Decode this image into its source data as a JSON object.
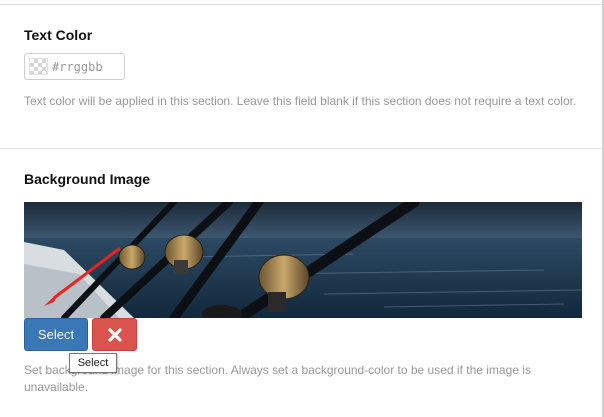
{
  "text_color": {
    "label": "Text Color",
    "input_placeholder": "#rrggbb",
    "input_value": "",
    "help": "Text color will be applied in this section. Leave this field blank if this section does not require a text color."
  },
  "background_image": {
    "label": "Background Image",
    "select_label": "Select",
    "remove_icon": "x-icon",
    "tooltip": "Select",
    "help": "Set background image for this section. Always set a background-color to be used if the image is unavailable."
  },
  "colors": {
    "select_button": "#3a77b7",
    "remove_button": "#d9534f",
    "arrow_annotation": "#e8251f"
  }
}
